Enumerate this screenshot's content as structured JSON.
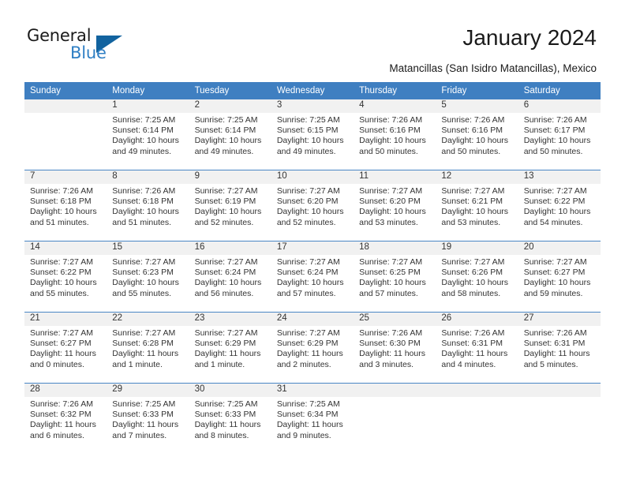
{
  "brand": {
    "name_part1": "General",
    "name_part2": "Blue",
    "accent_color": "#2f7fc4",
    "triangle_color": "#12639f"
  },
  "header": {
    "title": "January 2024",
    "subtitle": "Matancillas (San Isidro Matancillas), Mexico",
    "header_bar_color": "#3f7fc1"
  },
  "calendar": {
    "weekday_headers": [
      "Sunday",
      "Monday",
      "Tuesday",
      "Wednesday",
      "Thursday",
      "Friday",
      "Saturday"
    ],
    "weeks": [
      [
        {
          "day": "",
          "sunrise": "",
          "sunset": "",
          "daylight1": "",
          "daylight2": ""
        },
        {
          "day": "1",
          "sunrise": "Sunrise: 7:25 AM",
          "sunset": "Sunset: 6:14 PM",
          "daylight1": "Daylight: 10 hours",
          "daylight2": "and 49 minutes."
        },
        {
          "day": "2",
          "sunrise": "Sunrise: 7:25 AM",
          "sunset": "Sunset: 6:14 PM",
          "daylight1": "Daylight: 10 hours",
          "daylight2": "and 49 minutes."
        },
        {
          "day": "3",
          "sunrise": "Sunrise: 7:25 AM",
          "sunset": "Sunset: 6:15 PM",
          "daylight1": "Daylight: 10 hours",
          "daylight2": "and 49 minutes."
        },
        {
          "day": "4",
          "sunrise": "Sunrise: 7:26 AM",
          "sunset": "Sunset: 6:16 PM",
          "daylight1": "Daylight: 10 hours",
          "daylight2": "and 50 minutes."
        },
        {
          "day": "5",
          "sunrise": "Sunrise: 7:26 AM",
          "sunset": "Sunset: 6:16 PM",
          "daylight1": "Daylight: 10 hours",
          "daylight2": "and 50 minutes."
        },
        {
          "day": "6",
          "sunrise": "Sunrise: 7:26 AM",
          "sunset": "Sunset: 6:17 PM",
          "daylight1": "Daylight: 10 hours",
          "daylight2": "and 50 minutes."
        }
      ],
      [
        {
          "day": "7",
          "sunrise": "Sunrise: 7:26 AM",
          "sunset": "Sunset: 6:18 PM",
          "daylight1": "Daylight: 10 hours",
          "daylight2": "and 51 minutes."
        },
        {
          "day": "8",
          "sunrise": "Sunrise: 7:26 AM",
          "sunset": "Sunset: 6:18 PM",
          "daylight1": "Daylight: 10 hours",
          "daylight2": "and 51 minutes."
        },
        {
          "day": "9",
          "sunrise": "Sunrise: 7:27 AM",
          "sunset": "Sunset: 6:19 PM",
          "daylight1": "Daylight: 10 hours",
          "daylight2": "and 52 minutes."
        },
        {
          "day": "10",
          "sunrise": "Sunrise: 7:27 AM",
          "sunset": "Sunset: 6:20 PM",
          "daylight1": "Daylight: 10 hours",
          "daylight2": "and 52 minutes."
        },
        {
          "day": "11",
          "sunrise": "Sunrise: 7:27 AM",
          "sunset": "Sunset: 6:20 PM",
          "daylight1": "Daylight: 10 hours",
          "daylight2": "and 53 minutes."
        },
        {
          "day": "12",
          "sunrise": "Sunrise: 7:27 AM",
          "sunset": "Sunset: 6:21 PM",
          "daylight1": "Daylight: 10 hours",
          "daylight2": "and 53 minutes."
        },
        {
          "day": "13",
          "sunrise": "Sunrise: 7:27 AM",
          "sunset": "Sunset: 6:22 PM",
          "daylight1": "Daylight: 10 hours",
          "daylight2": "and 54 minutes."
        }
      ],
      [
        {
          "day": "14",
          "sunrise": "Sunrise: 7:27 AM",
          "sunset": "Sunset: 6:22 PM",
          "daylight1": "Daylight: 10 hours",
          "daylight2": "and 55 minutes."
        },
        {
          "day": "15",
          "sunrise": "Sunrise: 7:27 AM",
          "sunset": "Sunset: 6:23 PM",
          "daylight1": "Daylight: 10 hours",
          "daylight2": "and 55 minutes."
        },
        {
          "day": "16",
          "sunrise": "Sunrise: 7:27 AM",
          "sunset": "Sunset: 6:24 PM",
          "daylight1": "Daylight: 10 hours",
          "daylight2": "and 56 minutes."
        },
        {
          "day": "17",
          "sunrise": "Sunrise: 7:27 AM",
          "sunset": "Sunset: 6:24 PM",
          "daylight1": "Daylight: 10 hours",
          "daylight2": "and 57 minutes."
        },
        {
          "day": "18",
          "sunrise": "Sunrise: 7:27 AM",
          "sunset": "Sunset: 6:25 PM",
          "daylight1": "Daylight: 10 hours",
          "daylight2": "and 57 minutes."
        },
        {
          "day": "19",
          "sunrise": "Sunrise: 7:27 AM",
          "sunset": "Sunset: 6:26 PM",
          "daylight1": "Daylight: 10 hours",
          "daylight2": "and 58 minutes."
        },
        {
          "day": "20",
          "sunrise": "Sunrise: 7:27 AM",
          "sunset": "Sunset: 6:27 PM",
          "daylight1": "Daylight: 10 hours",
          "daylight2": "and 59 minutes."
        }
      ],
      [
        {
          "day": "21",
          "sunrise": "Sunrise: 7:27 AM",
          "sunset": "Sunset: 6:27 PM",
          "daylight1": "Daylight: 11 hours",
          "daylight2": "and 0 minutes."
        },
        {
          "day": "22",
          "sunrise": "Sunrise: 7:27 AM",
          "sunset": "Sunset: 6:28 PM",
          "daylight1": "Daylight: 11 hours",
          "daylight2": "and 1 minute."
        },
        {
          "day": "23",
          "sunrise": "Sunrise: 7:27 AM",
          "sunset": "Sunset: 6:29 PM",
          "daylight1": "Daylight: 11 hours",
          "daylight2": "and 1 minute."
        },
        {
          "day": "24",
          "sunrise": "Sunrise: 7:27 AM",
          "sunset": "Sunset: 6:29 PM",
          "daylight1": "Daylight: 11 hours",
          "daylight2": "and 2 minutes."
        },
        {
          "day": "25",
          "sunrise": "Sunrise: 7:26 AM",
          "sunset": "Sunset: 6:30 PM",
          "daylight1": "Daylight: 11 hours",
          "daylight2": "and 3 minutes."
        },
        {
          "day": "26",
          "sunrise": "Sunrise: 7:26 AM",
          "sunset": "Sunset: 6:31 PM",
          "daylight1": "Daylight: 11 hours",
          "daylight2": "and 4 minutes."
        },
        {
          "day": "27",
          "sunrise": "Sunrise: 7:26 AM",
          "sunset": "Sunset: 6:31 PM",
          "daylight1": "Daylight: 11 hours",
          "daylight2": "and 5 minutes."
        }
      ],
      [
        {
          "day": "28",
          "sunrise": "Sunrise: 7:26 AM",
          "sunset": "Sunset: 6:32 PM",
          "daylight1": "Daylight: 11 hours",
          "daylight2": "and 6 minutes."
        },
        {
          "day": "29",
          "sunrise": "Sunrise: 7:25 AM",
          "sunset": "Sunset: 6:33 PM",
          "daylight1": "Daylight: 11 hours",
          "daylight2": "and 7 minutes."
        },
        {
          "day": "30",
          "sunrise": "Sunrise: 7:25 AM",
          "sunset": "Sunset: 6:33 PM",
          "daylight1": "Daylight: 11 hours",
          "daylight2": "and 8 minutes."
        },
        {
          "day": "31",
          "sunrise": "Sunrise: 7:25 AM",
          "sunset": "Sunset: 6:34 PM",
          "daylight1": "Daylight: 11 hours",
          "daylight2": "and 9 minutes."
        },
        {
          "day": "",
          "sunrise": "",
          "sunset": "",
          "daylight1": "",
          "daylight2": ""
        },
        {
          "day": "",
          "sunrise": "",
          "sunset": "",
          "daylight1": "",
          "daylight2": ""
        },
        {
          "day": "",
          "sunrise": "",
          "sunset": "",
          "daylight1": "",
          "daylight2": ""
        }
      ]
    ]
  }
}
